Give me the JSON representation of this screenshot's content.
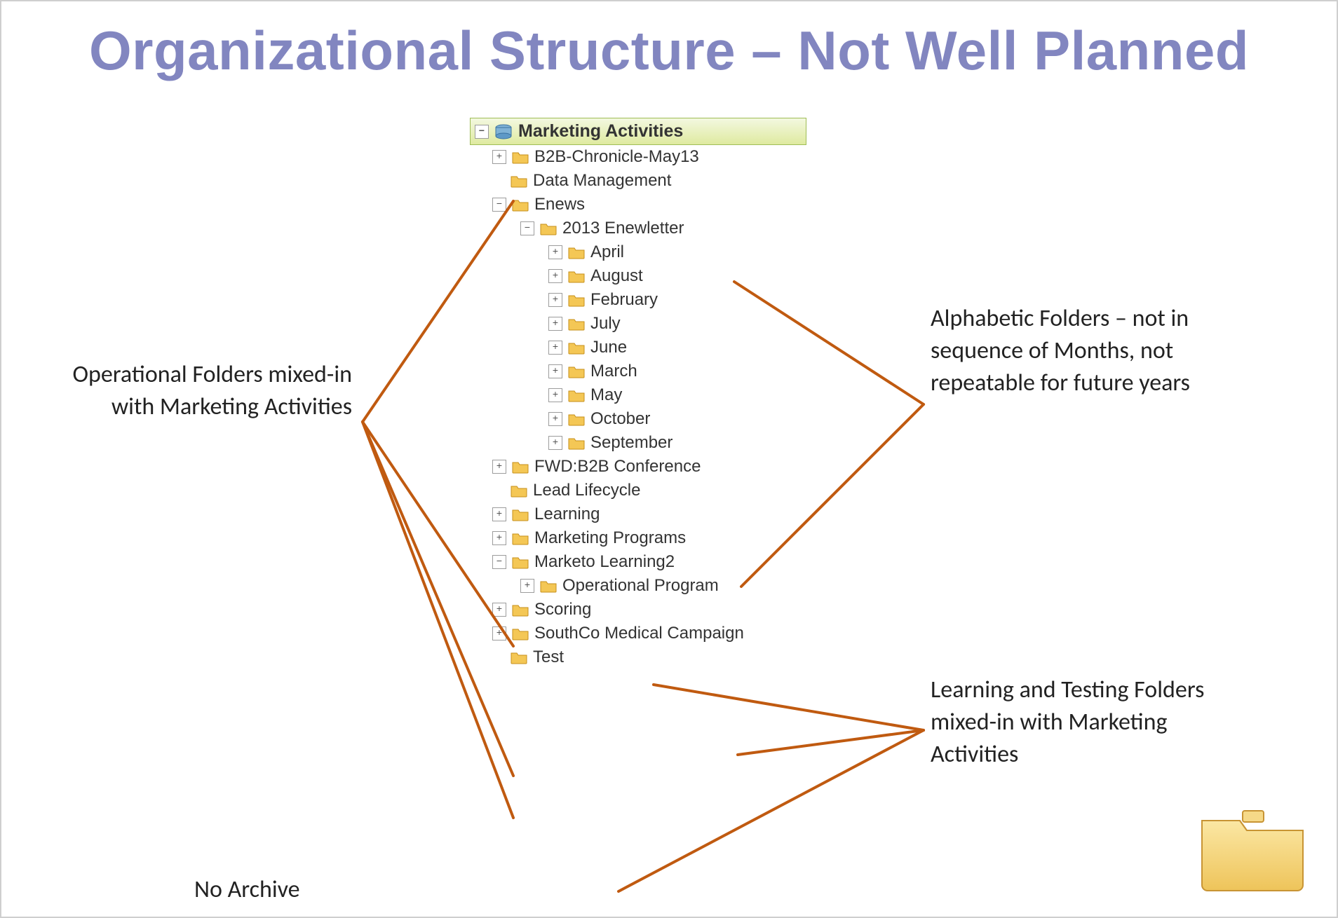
{
  "title": "Organizational Structure – Not Well Planned",
  "root_label": "Marketing Activities",
  "nodes": {
    "b2b": "B2B-Chronicle-May13",
    "datamgmt": "Data Management",
    "enews": "Enews",
    "enews2013": "2013 Enewletter",
    "april": "April",
    "august": "August",
    "february": "February",
    "july": "July",
    "june": "June",
    "march": "March",
    "may": "May",
    "october": "October",
    "september": "September",
    "fwdb2b": "FWD:B2B Conference",
    "leadlife": "Lead Lifecycle",
    "learning": "Learning",
    "mktprog": "Marketing Programs",
    "mktolearn2": "Marketo Learning2",
    "opprogram": "Operational Program",
    "scoring": "Scoring",
    "southco": "SouthCo Medical Campaign",
    "test": "Test"
  },
  "annotations": {
    "left1": "Operational Folders mixed-in with Marketing Activities",
    "right1": "Alphabetic Folders – not in sequence of Months, not repeatable for future years",
    "right2": "Learning and Testing Folders mixed-in with Marketing Activities",
    "bottomleft": "No Archive"
  }
}
